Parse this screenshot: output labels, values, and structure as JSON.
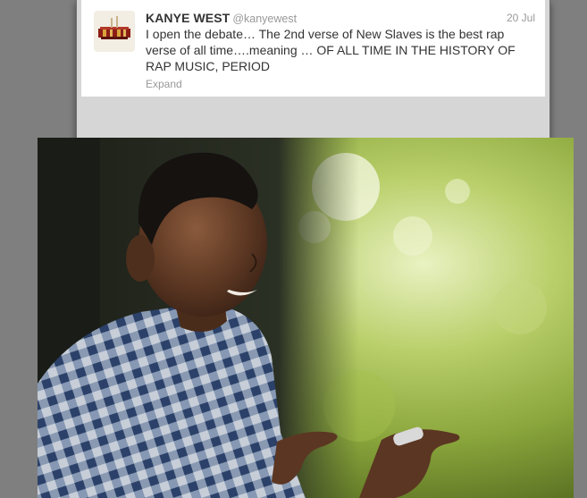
{
  "tweet": {
    "author_name": "KANYE WEST",
    "author_handle": "@kanyewest",
    "date": "20 Jul",
    "text": "I open the debate… The 2nd verse of New Slaves is the best rap verse of all time….meaning … OF ALL TIME IN THE HISTORY OF RAP MUSIC, PERIOD",
    "expand_label": "Expand"
  },
  "photo": {
    "subject": "smiling-man-plaid-shirt"
  },
  "colors": {
    "overlay": "#7f7f7f",
    "card": "#ffffff",
    "text": "#333333",
    "muted": "#999999"
  }
}
